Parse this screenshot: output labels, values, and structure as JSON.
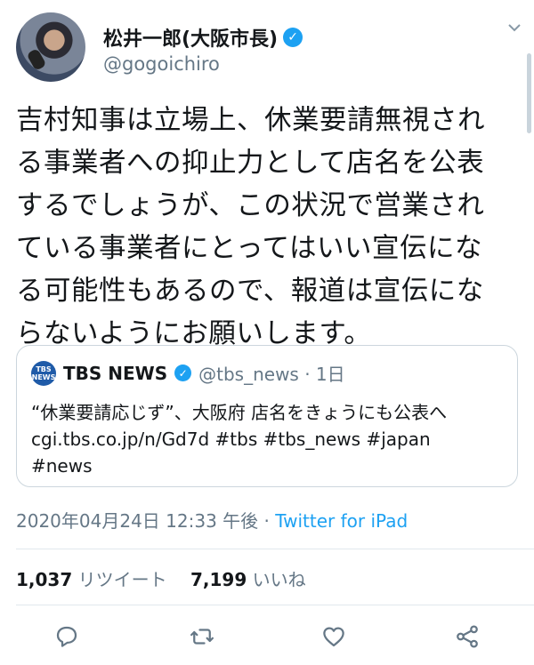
{
  "user": {
    "display_name": "松井一郎(大阪市長)",
    "handle": "@gogoichiro"
  },
  "tweet": {
    "lines": [
      "吉村知事は立場上、休業要請無視され",
      "る事業者への抑止力として店名を公表",
      "するでしょうが、この状況で営業され",
      "ている事業者にとってはいい宣伝にな",
      "る可能性もあるので、報道は宣伝にな",
      "らないようにお願いします。"
    ]
  },
  "quote": {
    "logo_top": "TBS",
    "logo_bottom": "NEWS",
    "name": "TBS NEWS",
    "meta": "@tbs_news · 1日",
    "lines": [
      "“休業要請応じず”、大阪府 店名をきょうにも公表へ",
      "cgi.tbs.co.jp/n/Gd7d #tbs #tbs_news #japan",
      "#news"
    ]
  },
  "timestamp": {
    "datetime": "2020年04月24日 12:33 午後 · ",
    "source": "Twitter for iPad"
  },
  "stats": {
    "retweets": "1,037",
    "retweets_label": "リツイート",
    "likes": "7,199",
    "likes_label": "いいね"
  },
  "colors": {
    "accent": "#1da1f2",
    "secondary_text": "#657786",
    "border": "#ccd6dd"
  },
  "icons": {
    "verified": "verified-badge-icon",
    "menu": "chevron-down-icon",
    "reply": "reply-icon",
    "retweet": "retweet-icon",
    "like": "heart-icon",
    "share": "share-icon"
  }
}
